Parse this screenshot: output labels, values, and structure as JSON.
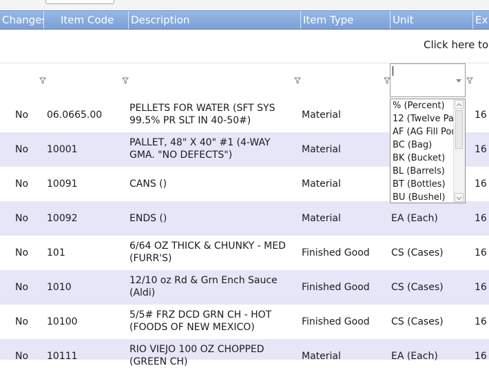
{
  "columns": {
    "changes": "Changes",
    "item_code": "Item Code",
    "description": "Description",
    "item_type": "Item Type",
    "unit": "Unit",
    "extra": "Ex"
  },
  "command": {
    "link": "Click here to a"
  },
  "unit_filter": {
    "value": "",
    "options": [
      "% (Percent)",
      "12 (Twelve Pac",
      "AF (AG Fill Pou",
      "BC (Bag)",
      "BK (Bucket)",
      "BL (Barrels)",
      "BT (Bottles)",
      "BU (Bushel)"
    ]
  },
  "rows": [
    {
      "changes": "No",
      "code": "06.0665.00",
      "desc1": "PELLETS FOR WATER (SFT SYS",
      "desc2": "99.5% PR SLT IN 40-50#)",
      "type": "Material",
      "unit": "",
      "extra": "16"
    },
    {
      "changes": "No",
      "code": "10001",
      "desc1": "PALLET, 48\" X 40\" #1 (4-WAY",
      "desc2": "GMA. \"NO DEFECTS\")",
      "type": "Material",
      "unit": "",
      "extra": "16"
    },
    {
      "changes": "No",
      "code": "10091",
      "desc1": "CANS ()",
      "desc2": "",
      "type": "Material",
      "unit": "",
      "extra": "16"
    },
    {
      "changes": "No",
      "code": "10092",
      "desc1": "ENDS ()",
      "desc2": "",
      "type": "Material",
      "unit": "EA (Each)",
      "extra": "16"
    },
    {
      "changes": "No",
      "code": "101",
      "desc1": "6/64 OZ THICK & CHUNKY - MED",
      "desc2": "(FURR'S)",
      "type": "Finished Good",
      "unit": "CS (Cases)",
      "extra": "16"
    },
    {
      "changes": "No",
      "code": "1010",
      "desc1": "12/10 oz Rd & Grn Ench Sauce",
      "desc2": "(Aldi)",
      "type": "Finished Good",
      "unit": "CS (Cases)",
      "extra": "16"
    },
    {
      "changes": "No",
      "code": "10100",
      "desc1": "5/5# FRZ DCD GRN CH - HOT",
      "desc2": "(FOODS OF NEW MEXICO)",
      "type": "Finished Good",
      "unit": "CS (Cases)",
      "extra": "16"
    },
    {
      "changes": "No",
      "code": "10111",
      "desc1": "RIO VIEJO 100 OZ CHOPPED",
      "desc2": "(GREEN CH)",
      "type": "Material",
      "unit": "EA (Each)",
      "extra": "16"
    }
  ]
}
